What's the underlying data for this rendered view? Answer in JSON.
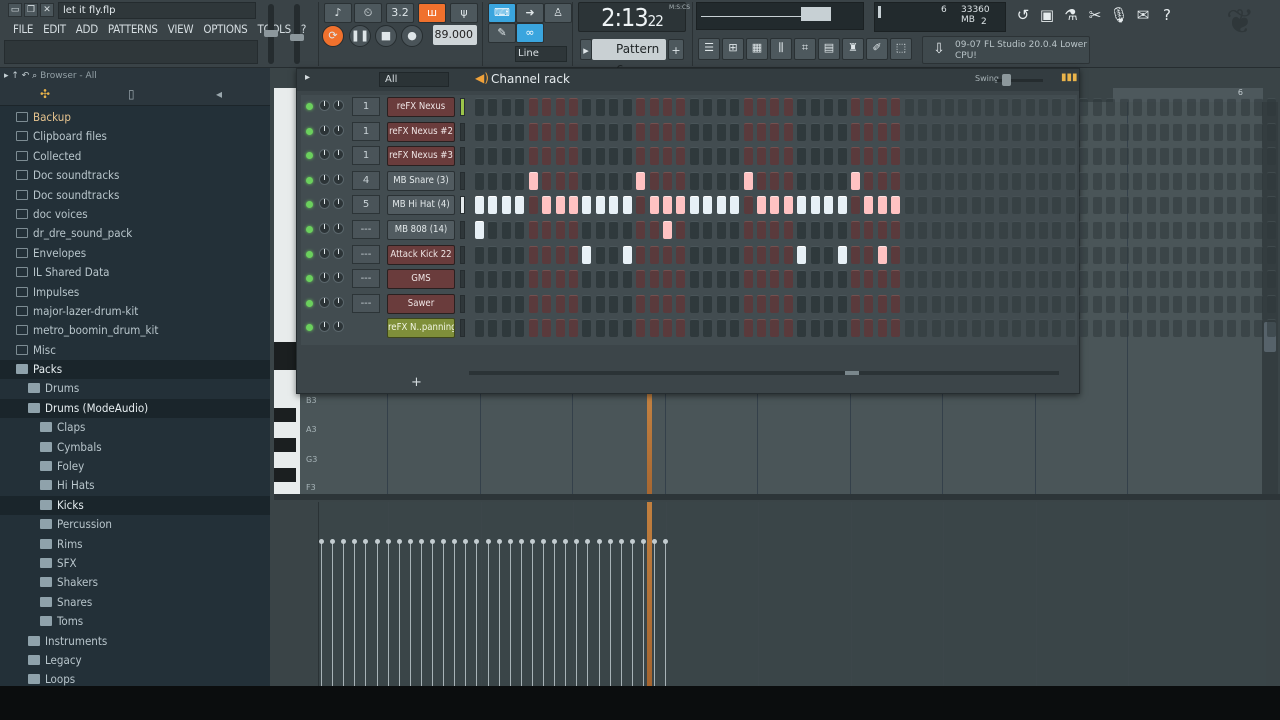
{
  "window": {
    "title": "let it fly.flp"
  },
  "menu": [
    "FILE",
    "EDIT",
    "ADD",
    "PATTERNS",
    "VIEW",
    "OPTIONS",
    "TOOLS",
    "?"
  ],
  "transport": {
    "time_main": "2:13",
    "time_sub": "22",
    "time_unit": "M:S:CS",
    "tempo": "89.000",
    "pattern": "Pattern 6",
    "snap_mode": "Line",
    "display_32": "3.2"
  },
  "status": {
    "cpu_num": "6",
    "memory": "33360 MB",
    "polyphony": "2",
    "news_line1": "09-07  FL Studio 20.0.4 Lower",
    "news_line2": "CPU!"
  },
  "browser": {
    "header": "Browser - All",
    "items": [
      {
        "label": "Backup",
        "type": "folder",
        "indent": 0,
        "first": true
      },
      {
        "label": "Clipboard files",
        "type": "folder",
        "indent": 0
      },
      {
        "label": "Collected",
        "type": "folder",
        "indent": 0
      },
      {
        "label": "Doc soundtracks",
        "type": "folder",
        "indent": 0
      },
      {
        "label": "Doc soundtracks",
        "type": "folder",
        "indent": 0
      },
      {
        "label": "doc voices",
        "type": "folder",
        "indent": 0
      },
      {
        "label": "dr_dre_sound_pack",
        "type": "folder",
        "indent": 0
      },
      {
        "label": "Envelopes",
        "type": "folder",
        "indent": 0
      },
      {
        "label": "IL Shared Data",
        "type": "folder",
        "indent": 0
      },
      {
        "label": "Impulses",
        "type": "folder",
        "indent": 0
      },
      {
        "label": "major-lazer-drum-kit",
        "type": "folder",
        "indent": 0
      },
      {
        "label": "metro_boomin_drum_kit",
        "type": "folder",
        "indent": 0
      },
      {
        "label": "Misc",
        "type": "folder",
        "indent": 0
      },
      {
        "label": "Packs",
        "type": "pack",
        "indent": 0,
        "selected": true
      },
      {
        "label": "Drums",
        "type": "pack",
        "indent": 1
      },
      {
        "label": "Drums (ModeAudio)",
        "type": "pack",
        "indent": 1,
        "selected": true
      },
      {
        "label": "Claps",
        "type": "pack",
        "indent": 2
      },
      {
        "label": "Cymbals",
        "type": "pack",
        "indent": 2
      },
      {
        "label": "Foley",
        "type": "pack",
        "indent": 2
      },
      {
        "label": "Hi Hats",
        "type": "pack",
        "indent": 2
      },
      {
        "label": "Kicks",
        "type": "pack",
        "indent": 2,
        "selected": true
      },
      {
        "label": "Percussion",
        "type": "pack",
        "indent": 2
      },
      {
        "label": "Rims",
        "type": "pack",
        "indent": 2
      },
      {
        "label": "SFX",
        "type": "pack",
        "indent": 2
      },
      {
        "label": "Shakers",
        "type": "pack",
        "indent": 2
      },
      {
        "label": "Snares",
        "type": "pack",
        "indent": 2
      },
      {
        "label": "Toms",
        "type": "pack",
        "indent": 2
      },
      {
        "label": "Instruments",
        "type": "pack",
        "indent": 1
      },
      {
        "label": "Legacy",
        "type": "pack",
        "indent": 1
      },
      {
        "label": "Loops",
        "type": "pack",
        "indent": 1
      }
    ]
  },
  "channel_rack": {
    "title": "Channel rack",
    "filter": "All",
    "swing_label": "Swing",
    "channels": [
      {
        "mixer": "1",
        "name": "reFX Nexus",
        "color": "red",
        "sel": "green",
        "steps": []
      },
      {
        "mixer": "1",
        "name": "reFX Nexus #2",
        "color": "red",
        "sel": "off",
        "steps": []
      },
      {
        "mixer": "1",
        "name": "reFX Nexus #3",
        "color": "red",
        "sel": "off",
        "steps": []
      },
      {
        "mixer": "4",
        "name": "MB Snare (3)",
        "color": "gray",
        "sel": "off",
        "steps": [
          4,
          12,
          20,
          28
        ]
      },
      {
        "mixer": "5",
        "name": "MB Hi Hat (4)",
        "color": "gray",
        "sel": "on",
        "steps": [
          0,
          1,
          2,
          3,
          5,
          6,
          7,
          8,
          9,
          10,
          11,
          13,
          14,
          15,
          16,
          17,
          18,
          19,
          21,
          22,
          23,
          24,
          25,
          26,
          27,
          29,
          30,
          31
        ]
      },
      {
        "mixer": "---",
        "name": "MB 808 (14)",
        "color": "gray",
        "sel": "off",
        "steps": [
          0,
          14
        ]
      },
      {
        "mixer": "---",
        "name": "Attack Kick 22",
        "color": "red",
        "sel": "off",
        "steps": [
          8,
          11,
          24,
          27,
          30
        ]
      },
      {
        "mixer": "---",
        "name": "GMS",
        "color": "red",
        "sel": "off",
        "steps": []
      },
      {
        "mixer": "---",
        "name": "Sawer",
        "color": "red",
        "sel": "off",
        "steps": []
      },
      {
        "mixer": "",
        "name": "reFX N..panning",
        "color": "green",
        "sel": "off",
        "steps": []
      }
    ]
  },
  "piano_roll": {
    "key_labels": [
      "B3",
      "A3",
      "G3",
      "F3"
    ],
    "bar_marker": "6"
  }
}
